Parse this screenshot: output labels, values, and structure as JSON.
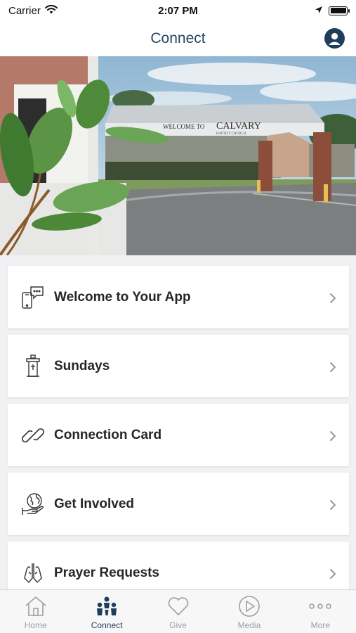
{
  "status_bar": {
    "carrier": "Carrier",
    "time": "2:07 PM"
  },
  "nav": {
    "title": "Connect"
  },
  "hero": {
    "sign_prefix": "WELCOME TO",
    "sign_name": "CALVARY",
    "sign_sub": "BAPTIST CHURCH"
  },
  "menu": {
    "items": [
      {
        "label": "Welcome to Your App",
        "icon": "phone-chat-icon"
      },
      {
        "label": "Sundays",
        "icon": "pulpit-icon"
      },
      {
        "label": "Connection Card",
        "icon": "link-icon"
      },
      {
        "label": "Get Involved",
        "icon": "globe-hand-icon"
      },
      {
        "label": "Prayer Requests",
        "icon": "praying-hands-icon"
      }
    ]
  },
  "tabs": [
    {
      "label": "Home",
      "icon": "home-icon",
      "active": false
    },
    {
      "label": "Connect",
      "icon": "people-icon",
      "active": true
    },
    {
      "label": "Give",
      "icon": "heart-icon",
      "active": false
    },
    {
      "label": "Media",
      "icon": "play-icon",
      "active": false
    },
    {
      "label": "More",
      "icon": "more-dots-icon",
      "active": false
    }
  ],
  "colors": {
    "accent": "#1f3d5c",
    "inactive_tab": "#9aa0a6",
    "background": "#f1f1f3"
  }
}
